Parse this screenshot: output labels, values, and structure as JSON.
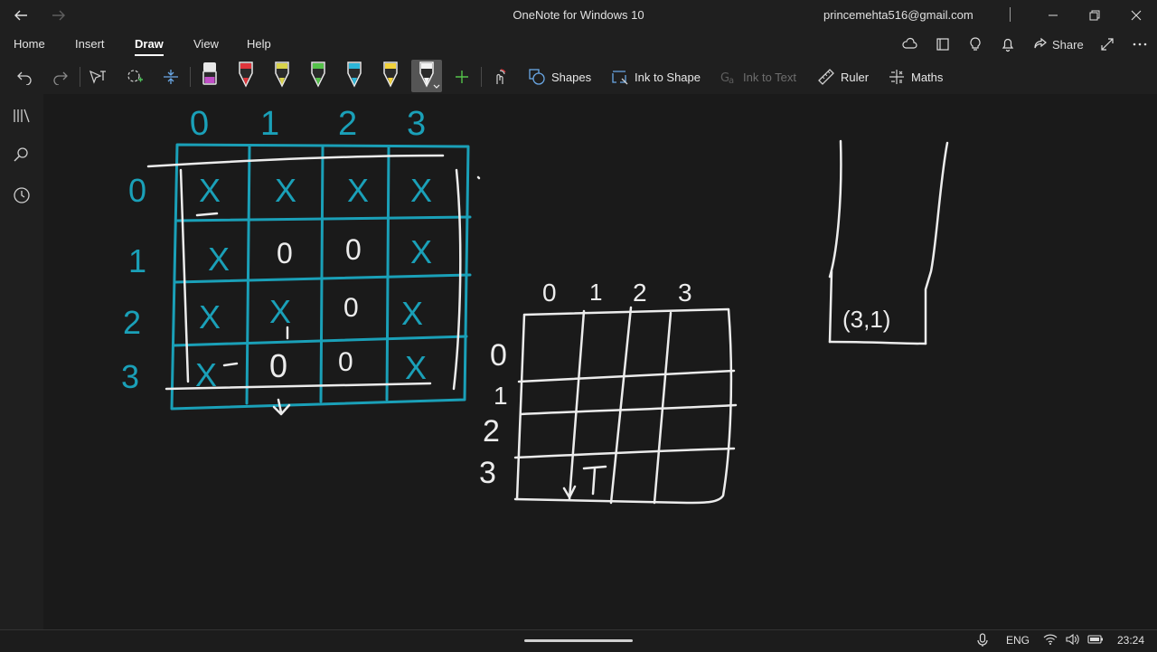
{
  "window": {
    "title": "OneNote for Windows 10",
    "account": "princemehta516@gmail.com"
  },
  "tabs": [
    "Home",
    "Insert",
    "Draw",
    "View",
    "Help"
  ],
  "ribbon_right": {
    "share_label": "Share"
  },
  "toolbar": {
    "shapes_label": "Shapes",
    "ink_to_shape_label": "Ink to Shape",
    "ink_to_text_label": "Ink to Text",
    "ruler_label": "Ruler",
    "maths_label": "Maths",
    "pens": [
      {
        "name": "pen-purple",
        "color": "#c04fc7"
      },
      {
        "name": "pen-red",
        "color": "#e0353b"
      },
      {
        "name": "pen-yellow-green",
        "color": "#d8d24a"
      },
      {
        "name": "pen-green",
        "color": "#55c24a"
      },
      {
        "name": "pen-cyan",
        "color": "#2db6d8"
      },
      {
        "name": "pen-yellow",
        "color": "#f2d23c"
      },
      {
        "name": "pen-white",
        "color": "#f2f2f2"
      }
    ]
  },
  "canvas": {
    "grid1": {
      "col_labels": [
        "0",
        "1",
        "2",
        "3"
      ],
      "row_labels": [
        "0",
        "1",
        "2",
        "3"
      ],
      "cells": [
        [
          "X",
          "X",
          "X",
          "X"
        ],
        [
          "X",
          "0",
          "0",
          "X"
        ],
        [
          "X",
          "X",
          "0",
          "X"
        ],
        [
          "X",
          "0",
          "0",
          "X"
        ]
      ]
    },
    "grid2": {
      "col_labels": [
        "0",
        "1",
        "2",
        "3"
      ],
      "row_labels": [
        "0",
        "1",
        "2",
        "3"
      ],
      "mark": "T"
    },
    "stack": {
      "entry": "(3,1)"
    }
  },
  "taskbar": {
    "language": "ENG",
    "time": "23:24"
  },
  "colors": {
    "ink_teal": "#1aa0b8",
    "ink_white": "#ececec",
    "background": "#1a1a1a"
  }
}
